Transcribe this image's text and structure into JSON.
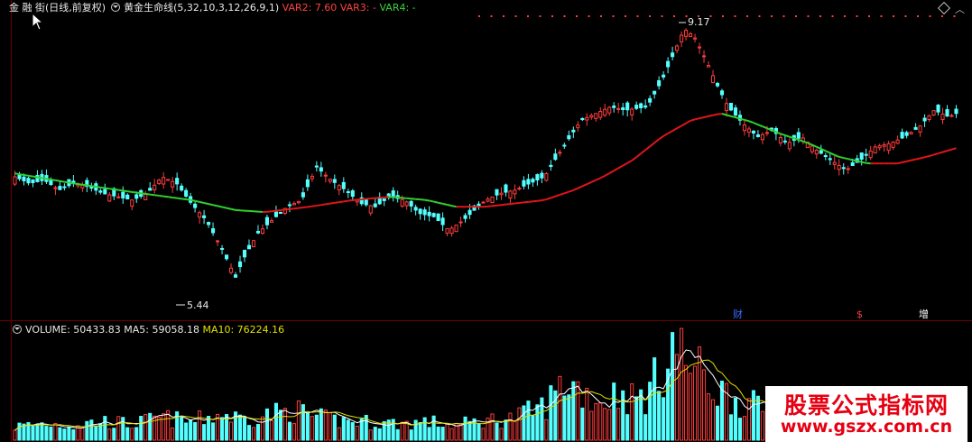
{
  "header": {
    "title": "金 融 街(日线,前复权)",
    "indicator_name": "黄金生命线(5,32,10,3,12,26,9,1)",
    "var2": "VAR2: 7.60",
    "var3": "VAR3: -",
    "var4": "VAR4: -"
  },
  "chart_annotations": {
    "high_label": "9.17",
    "low_label": "5.44"
  },
  "event_markers": [
    {
      "text": "财",
      "color": "#3a6cff"
    },
    {
      "text": "$",
      "color": "#ff4040"
    },
    {
      "text": "增",
      "color": "#ffffff"
    }
  ],
  "volume_header": {
    "volume": "VOLUME: 50433.83",
    "ma5": "MA5: 59058.18",
    "ma10": "MA10: 76224.16"
  },
  "watermark": {
    "title": "股票公式指标网",
    "url": "www.gszx.com.cn"
  },
  "colors": {
    "up": "#ff3c3c",
    "down": "#54ffff",
    "line_up": "#e0161a",
    "line_down": "#2fd02f",
    "ma5": "#ffffff",
    "ma10": "#e0e000"
  },
  "chart_data": {
    "type": "candlestick",
    "price_range": [
      5.0,
      9.4
    ],
    "volume_range": [
      0,
      140000
    ],
    "price_path": [
      [
        0,
        6.95
      ],
      [
        10,
        6.85
      ],
      [
        20,
        6.9
      ],
      [
        30,
        6.75
      ],
      [
        40,
        6.85
      ],
      [
        50,
        6.8
      ],
      [
        60,
        6.7
      ],
      [
        70,
        6.65
      ],
      [
        80,
        6.6
      ],
      [
        90,
        6.7
      ],
      [
        100,
        6.95
      ],
      [
        110,
        6.85
      ],
      [
        120,
        6.55
      ],
      [
        130,
        6.3
      ],
      [
        140,
        5.9
      ],
      [
        150,
        5.44
      ],
      [
        155,
        5.7
      ],
      [
        165,
        6.1
      ],
      [
        175,
        6.3
      ],
      [
        185,
        6.5
      ],
      [
        195,
        6.6
      ],
      [
        205,
        7.1
      ],
      [
        215,
        6.9
      ],
      [
        225,
        6.75
      ],
      [
        235,
        6.55
      ],
      [
        245,
        6.5
      ],
      [
        255,
        6.65
      ],
      [
        265,
        6.6
      ],
      [
        275,
        6.4
      ],
      [
        285,
        6.35
      ],
      [
        295,
        6.15
      ],
      [
        305,
        6.3
      ],
      [
        320,
        6.6
      ],
      [
        330,
        6.7
      ],
      [
        340,
        6.75
      ],
      [
        350,
        6.85
      ],
      [
        360,
        6.95
      ],
      [
        370,
        7.3
      ],
      [
        385,
        7.8
      ],
      [
        395,
        7.9
      ],
      [
        405,
        8.0
      ],
      [
        415,
        7.95
      ],
      [
        430,
        8.0
      ],
      [
        440,
        8.4
      ],
      [
        448,
        8.8
      ],
      [
        455,
        9.17
      ],
      [
        462,
        9.05
      ],
      [
        470,
        8.7
      ],
      [
        478,
        8.3
      ],
      [
        485,
        8.0
      ],
      [
        495,
        7.75
      ],
      [
        505,
        7.55
      ],
      [
        515,
        7.65
      ],
      [
        525,
        7.45
      ],
      [
        535,
        7.55
      ],
      [
        545,
        7.35
      ],
      [
        555,
        7.2
      ],
      [
        565,
        7.05
      ],
      [
        575,
        7.2
      ],
      [
        585,
        7.4
      ],
      [
        595,
        7.45
      ],
      [
        605,
        7.55
      ],
      [
        615,
        7.7
      ],
      [
        625,
        7.95
      ],
      [
        635,
        7.85
      ],
      [
        640,
        7.9
      ]
    ],
    "gold_line": [
      [
        0,
        7.0
      ],
      [
        40,
        6.85
      ],
      [
        80,
        6.72
      ],
      [
        120,
        6.6
      ],
      [
        150,
        6.45
      ],
      [
        170,
        6.42
      ],
      [
        200,
        6.5
      ],
      [
        230,
        6.6
      ],
      [
        255,
        6.65
      ],
      [
        280,
        6.6
      ],
      [
        300,
        6.5
      ],
      [
        320,
        6.5
      ],
      [
        340,
        6.55
      ],
      [
        360,
        6.6
      ],
      [
        380,
        6.75
      ],
      [
        400,
        6.95
      ],
      [
        420,
        7.2
      ],
      [
        440,
        7.55
      ],
      [
        460,
        7.8
      ],
      [
        480,
        7.9
      ],
      [
        500,
        7.78
      ],
      [
        520,
        7.6
      ],
      [
        540,
        7.45
      ],
      [
        560,
        7.25
      ],
      [
        580,
        7.15
      ],
      [
        600,
        7.15
      ],
      [
        620,
        7.25
      ],
      [
        640,
        7.38
      ]
    ],
    "volume_path": [
      [
        0,
        18000
      ],
      [
        20,
        22000
      ],
      [
        40,
        20000
      ],
      [
        60,
        25000
      ],
      [
        80,
        21000
      ],
      [
        100,
        30000
      ],
      [
        120,
        24000
      ],
      [
        140,
        35000
      ],
      [
        155,
        28000
      ],
      [
        170,
        33000
      ],
      [
        190,
        40000
      ],
      [
        205,
        30000
      ],
      [
        220,
        26000
      ],
      [
        240,
        24000
      ],
      [
        260,
        22000
      ],
      [
        280,
        24000
      ],
      [
        300,
        20000
      ],
      [
        320,
        26000
      ],
      [
        340,
        30000
      ],
      [
        360,
        45000
      ],
      [
        375,
        80000
      ],
      [
        390,
        60000
      ],
      [
        400,
        50000
      ],
      [
        410,
        65000
      ],
      [
        420,
        55000
      ],
      [
        430,
        60000
      ],
      [
        440,
        95000
      ],
      [
        447,
        130000
      ],
      [
        455,
        110000
      ],
      [
        465,
        90000
      ],
      [
        475,
        70000
      ],
      [
        490,
        55000
      ],
      [
        510,
        40000
      ],
      [
        530,
        38000
      ],
      [
        550,
        30000
      ],
      [
        570,
        28000
      ],
      [
        590,
        32000
      ],
      [
        610,
        30000
      ],
      [
        630,
        30000
      ],
      [
        640,
        28000
      ]
    ]
  }
}
